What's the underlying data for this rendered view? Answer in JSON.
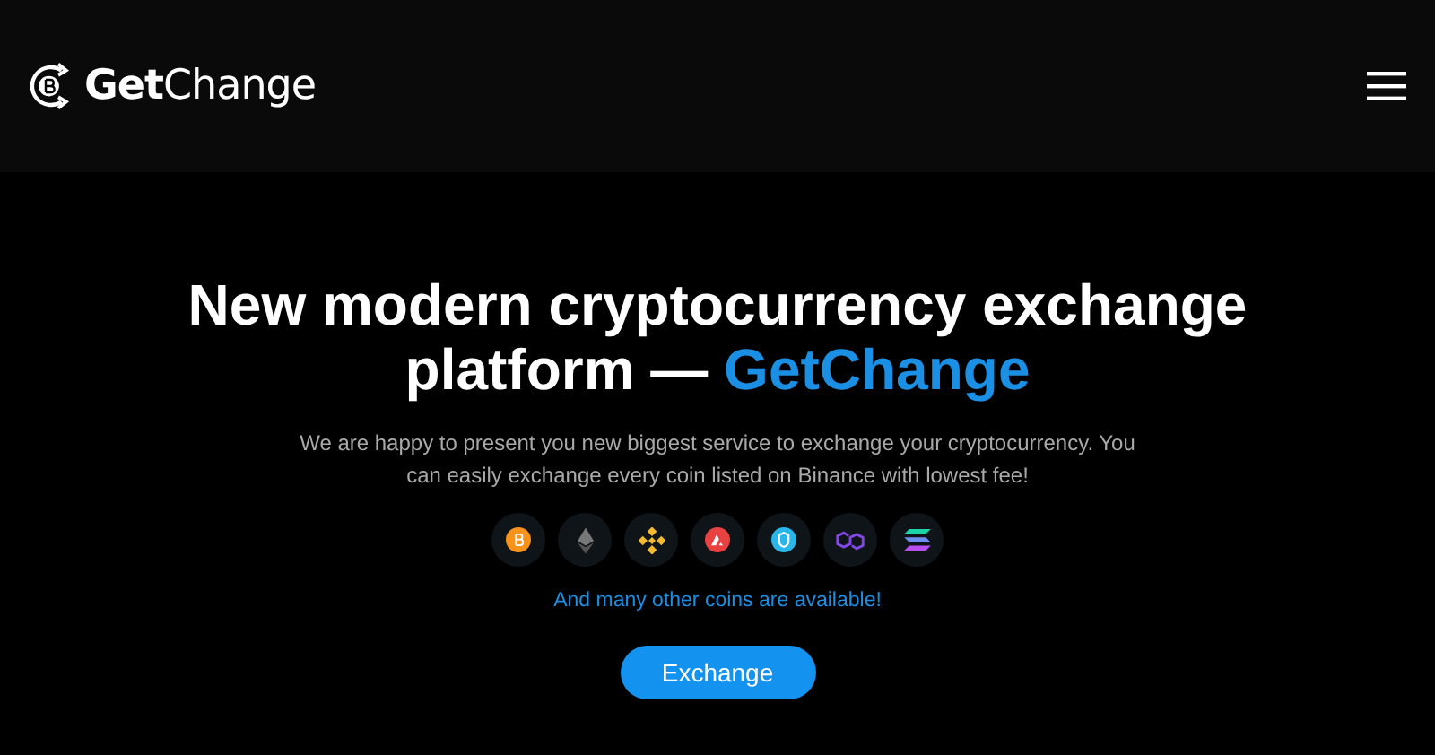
{
  "header": {
    "logo": "**Get**Change"
  },
  "hero": {
    "title": "New modern cryptocurrency exchange platform — ",
    "title_highlight": "GetChange",
    "subtitle": "We are happy to present you new biggest service to exchange your cryptocurrency. You can easily exchange every coin listed on Binance with lowest fee!",
    "coins": [
      {
        "kind": "bitcoin"
      },
      {
        "kind": "ethereum"
      },
      {
        "kind": "binance"
      },
      {
        "kind": "avalanche"
      },
      {
        "kind": "shield"
      },
      {
        "kind": "polygon"
      },
      {
        "kind": "solana"
      }
    ],
    "note": "And many other coins are available!",
    "button": "Exchange"
  }
}
